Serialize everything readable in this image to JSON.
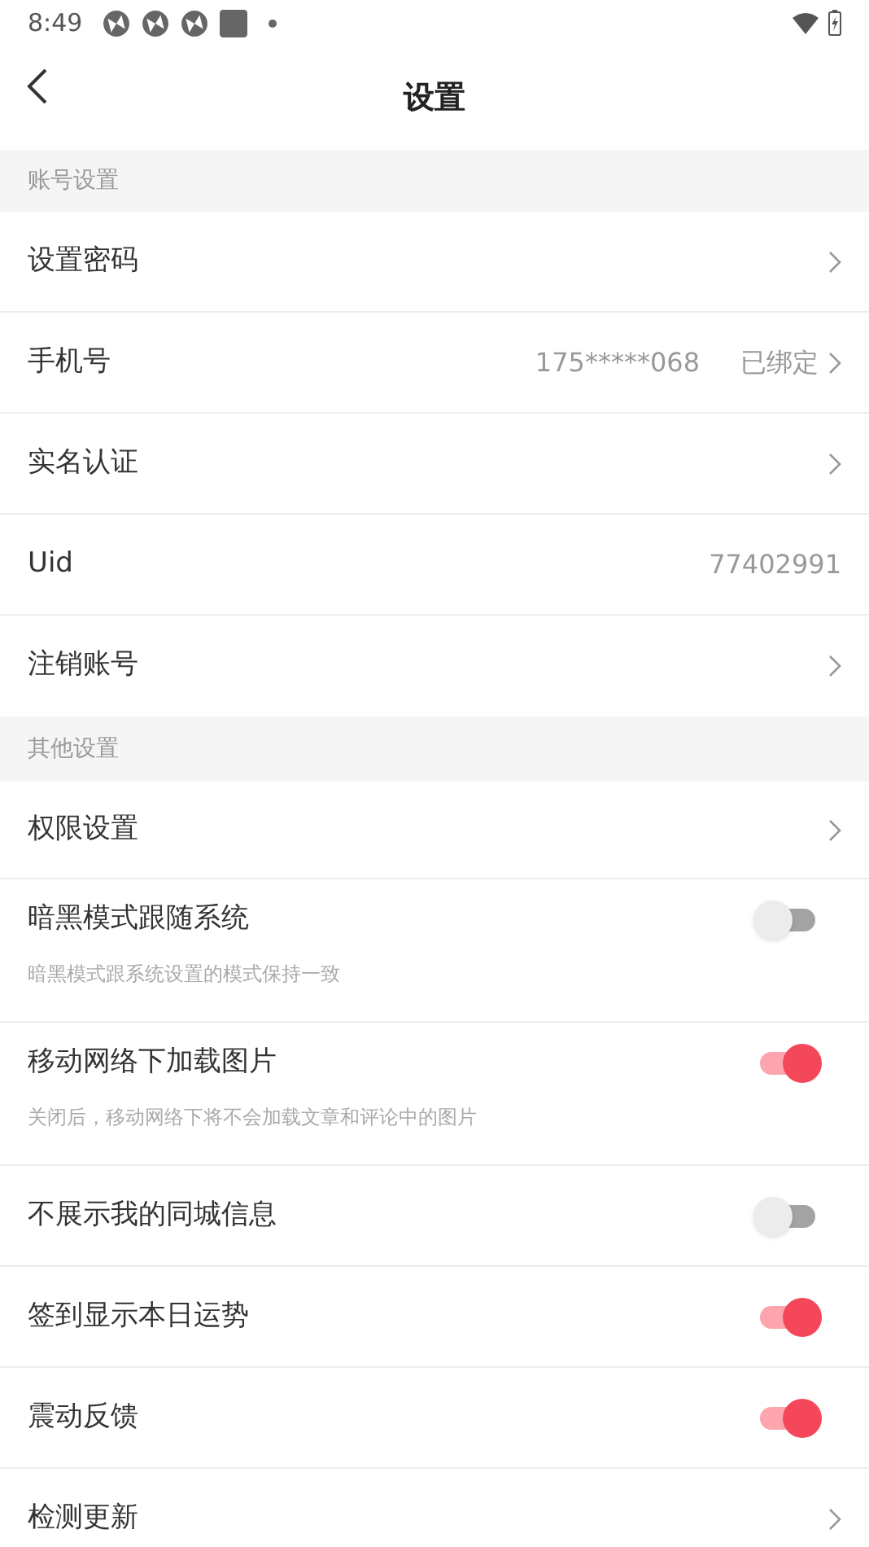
{
  "status_bar": {
    "time": "8:49"
  },
  "header": {
    "title": "设置"
  },
  "sections": [
    {
      "title": "账号设置",
      "rows": [
        {
          "kind": "link",
          "label": "设置密码"
        },
        {
          "kind": "value",
          "label": "手机号",
          "value": "175*****068",
          "status": "已绑定",
          "chevron": true
        },
        {
          "kind": "link",
          "label": "实名认证"
        },
        {
          "kind": "value",
          "label": "Uid",
          "value": "77402991",
          "chevron": false
        },
        {
          "kind": "link",
          "label": "注销账号"
        }
      ]
    },
    {
      "title": "其他设置",
      "rows": [
        {
          "kind": "link",
          "label": "权限设置"
        },
        {
          "kind": "toggle",
          "label": "暗黑模式跟随系统",
          "subtitle": "暗黑模式跟系统设置的模式保持一致",
          "on": false
        },
        {
          "kind": "toggle",
          "label": "移动网络下加载图片",
          "subtitle": "关闭后，移动网络下将不会加载文章和评论中的图片",
          "on": true
        },
        {
          "kind": "toggle",
          "label": "不展示我的同城信息",
          "on": false
        },
        {
          "kind": "toggle",
          "label": "签到显示本日运势",
          "on": true
        },
        {
          "kind": "toggle",
          "label": "震动反馈",
          "on": true
        },
        {
          "kind": "link",
          "label": "检测更新"
        }
      ]
    }
  ]
}
